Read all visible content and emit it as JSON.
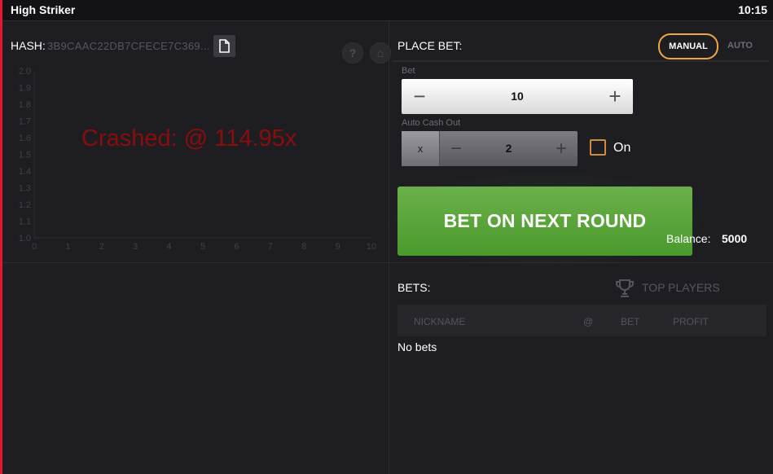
{
  "app": {
    "title": "High Striker",
    "clock": "10:15"
  },
  "hash": {
    "label": "HASH:",
    "value": "3B9CAAC22DB7CFECE7C369..."
  },
  "icons": {
    "copy": "file-copy-icon",
    "help": "question-icon",
    "home": "home-icon",
    "trophy": "trophy-icon",
    "help_glyph": "?",
    "home_glyph": "⌂"
  },
  "graph": {
    "crash_text": "Crashed: @ 114.95x",
    "x_ticks": [
      "0",
      "1",
      "2",
      "3",
      "4",
      "5",
      "6",
      "7",
      "8",
      "9",
      "10"
    ],
    "y_ticks": [
      "2.0",
      "1.9",
      "1.8",
      "1.7",
      "1.6",
      "1.5",
      "1.4",
      "1.3",
      "1.2",
      "1.1",
      "1.0"
    ]
  },
  "place_bet": {
    "label": "PLACE BET:",
    "mode_manual": "MANUAL",
    "mode_auto": "AUTO",
    "bet_label": "Bet",
    "bet_value": "10",
    "auto_cashout_label": "Auto Cash Out",
    "auto_cashout_prefix": "x",
    "auto_cashout_value": "2",
    "auto_cashout_on_label": "On",
    "auto_cashout_on": false,
    "minus": "−",
    "plus": "+",
    "bet_button": "BET ON NEXT ROUND",
    "balance_label": "Balance:",
    "balance_value": "5000"
  },
  "bets": {
    "label": "BETS:",
    "top_players": "TOP PLAYERS",
    "columns": [
      "NICKNAME",
      "@",
      "BET",
      "PROFIT"
    ],
    "empty": "No bets"
  },
  "colors": {
    "accent": "#f2a640",
    "crash": "#8b0c0c",
    "bet_button": "#5aa63a",
    "edge": "#e3172f"
  }
}
